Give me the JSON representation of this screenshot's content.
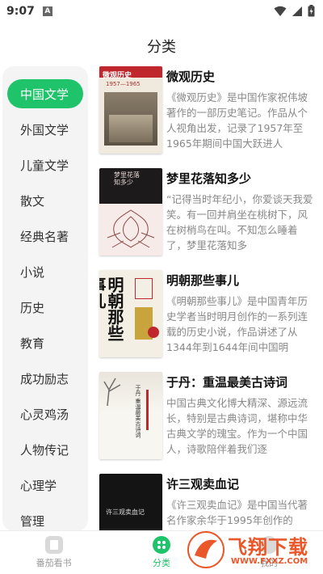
{
  "status_bar": {
    "time": "9:07",
    "notif_letter": "A"
  },
  "header": {
    "title": "分类"
  },
  "sidebar": {
    "items": [
      {
        "label": "中国文学"
      },
      {
        "label": "外国文学"
      },
      {
        "label": "儿童文学"
      },
      {
        "label": "散文"
      },
      {
        "label": "经典名著"
      },
      {
        "label": "小说"
      },
      {
        "label": "历史"
      },
      {
        "label": "教育"
      },
      {
        "label": "成功励志"
      },
      {
        "label": "心灵鸡汤"
      },
      {
        "label": "人物传记"
      },
      {
        "label": "心理学"
      },
      {
        "label": "管理"
      }
    ]
  },
  "books": [
    {
      "title": "微观历史",
      "desc": "《微观历史》是中国作家祝伟坡著作的一部历史笔记。作品从个人视角出发，记录了1957年至1965年期间中国大跃进人",
      "cover_text": "微观历史",
      "cover_sub": "1957—1965"
    },
    {
      "title": "梦里花落知多少",
      "desc": "“记得当时年纪小，你爱谈天我爱笑。有一回并肩坐在桃树下，风在树梢鸟在叫。不知怎么睡着了，梦里花落知多",
      "cover_text": "梦里花落知多少"
    },
    {
      "title": "明朝那些事儿",
      "desc": "《明朝那些事儿》是中国青年历史学者当时明月创作的一系列连载的历史小说，作品讲述了从1344年到1644年间中国明",
      "cover_text": "明朝那些事儿"
    },
    {
      "title": "于丹：重温最美古诗词",
      "desc": "中国古典文化博大精深、源远流长，特别是古典诗词，堪称中华古典文学的瑰宝。作为一个中国人，诗歌陪伴着我们逐",
      "cover_text": "于丹 重温最美古诗词"
    },
    {
      "title": "许三观卖血记",
      "desc": "《许三观卖血记》是中国当代著名作家余华于1995年创作的",
      "cover_text": "许三观卖血记"
    }
  ],
  "bottom_nav": {
    "tabs": [
      {
        "label": "番茄看书"
      },
      {
        "label": "分类"
      },
      {
        "label": "我的"
      }
    ]
  },
  "watermark": {
    "line1": "飞翔下载",
    "line2": "WWW.FXXZ.COM"
  },
  "colors": {
    "accent": "#1fc36a",
    "sidebar_bg": "#f4f4f4",
    "desc_text": "#888888"
  }
}
